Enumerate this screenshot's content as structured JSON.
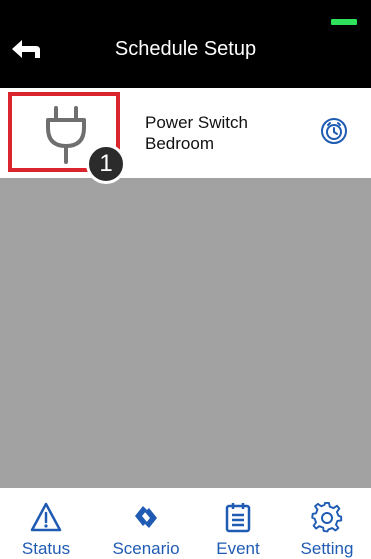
{
  "header": {
    "title": "Schedule Setup",
    "back_icon": "back-arrow-icon",
    "battery_color": "#2ee05a"
  },
  "device": {
    "name_line1": "Power Switch",
    "name_line2": "Bedroom",
    "icon": "power-plug-icon",
    "action_icon": "alarm-clock-icon",
    "highlight_color": "#d9252b",
    "callout_number": "1"
  },
  "nav": {
    "accent_color": "#1f5bb3",
    "items": [
      {
        "label": "Status",
        "icon": "warning-triangle-icon"
      },
      {
        "label": "Scenario",
        "icon": "scenario-icon"
      },
      {
        "label": "Event",
        "icon": "calendar-list-icon"
      },
      {
        "label": "Setting",
        "icon": "gear-icon"
      }
    ]
  },
  "colors": {
    "header_bg": "#000000",
    "content_bg": "#a2a2a2"
  }
}
